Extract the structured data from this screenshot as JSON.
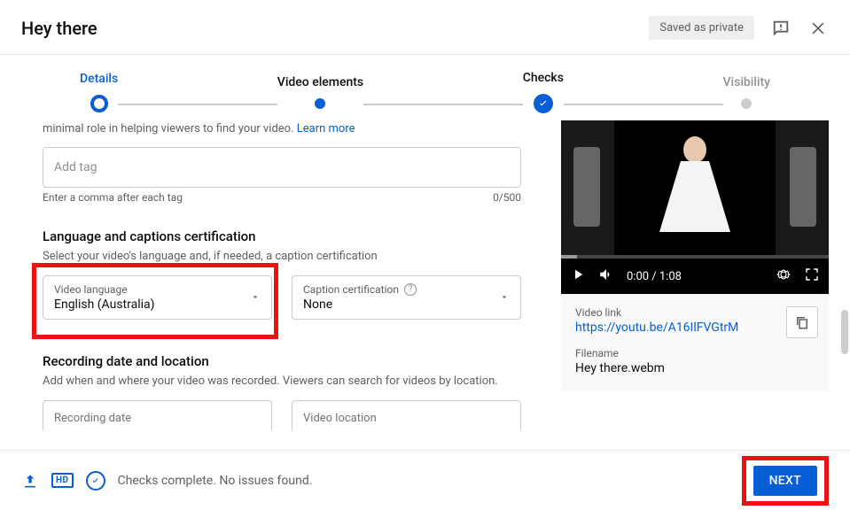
{
  "header": {
    "title": "Hey there",
    "saved_badge": "Saved as private"
  },
  "stepper": {
    "details": "Details",
    "video_elements": "Video elements",
    "checks": "Checks",
    "visibility": "Visibility"
  },
  "tags": {
    "fragment_text": "minimal role in helping viewers to find your video. ",
    "learn_more": "Learn more",
    "placeholder": "Add tag",
    "hint": "Enter a comma after each tag",
    "counter": "0/500"
  },
  "lang": {
    "section_title": "Language and captions certification",
    "section_sub": "Select your video's language and, if needed, a caption certification",
    "video_language_label": "Video language",
    "video_language_value": "English (Australia)",
    "caption_cert_label": "Caption certification",
    "caption_cert_value": "None"
  },
  "recording": {
    "section_title": "Recording date and location",
    "section_sub": "Add when and where your video was recorded. Viewers can search for videos by location.",
    "date_placeholder": "Recording date",
    "location_placeholder": "Video location"
  },
  "preview": {
    "time": "0:00 / 1:08",
    "link_label": "Video link",
    "link_value": "https://youtu.be/A16IlFVGtrM",
    "filename_label": "Filename",
    "filename_value": "Hey there.webm"
  },
  "footer": {
    "hd": "HD",
    "status": "Checks complete. No issues found.",
    "next": "NEXT"
  }
}
